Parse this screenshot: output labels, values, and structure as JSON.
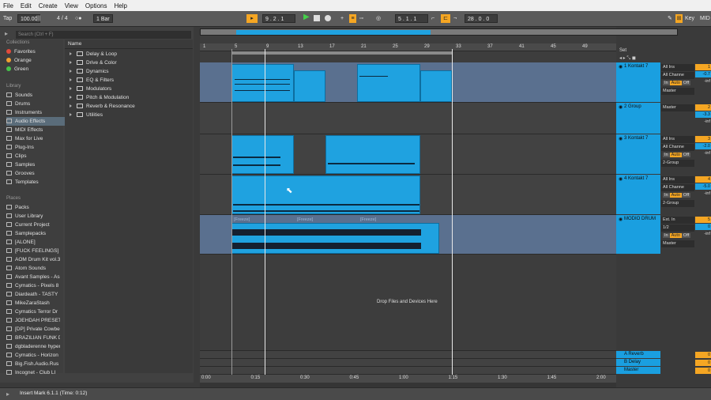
{
  "menu": [
    "File",
    "Edit",
    "Create",
    "View",
    "Options",
    "Help"
  ],
  "transport": {
    "tap": "Tap",
    "tempo": "100.00",
    "sig": "4 / 4",
    "quant": "1 Bar",
    "position": "9 . 2 . 1",
    "loop_start": "5 . 1 . 1",
    "loop_len": "28 . 0 . 0",
    "key": "Key",
    "midi": "MID"
  },
  "search_placeholder": "Search (Ctrl + F)",
  "collections": {
    "label": "Collections",
    "items": [
      {
        "name": "Favorites",
        "color": "#e24a3b"
      },
      {
        "name": "Orange",
        "color": "#f0a030"
      },
      {
        "name": "Green",
        "color": "#45c24a"
      }
    ]
  },
  "library": {
    "label": "Library",
    "items": [
      "Sounds",
      "Drums",
      "Instruments",
      "Audio Effects",
      "MIDI Effects",
      "Max for Live",
      "Plug-Ins",
      "Clips",
      "Samples",
      "Grooves",
      "Templates"
    ]
  },
  "places": {
    "label": "Places",
    "items": [
      "Packs",
      "User Library",
      "Current Project",
      "Samplepacks",
      "[ALONE]",
      "[FUCK FEELINGS] D",
      "AOM Drum Kit vol.3",
      "Atom Sounds",
      "Avant Samples - As",
      "Cymatics - Pixels 8",
      "Diardeath - TASTY",
      "MikeZaraStash",
      "Cymatics Terror Dr",
      "JOEHDAH PRESET S",
      "[DP] Private Cowbe",
      "BRAZILIAN FUNK D",
      "dgbladerenne hyper",
      "Cymatics - Horizon",
      "Big.Fish.Audio.Rus",
      "Incognet - Club LI"
    ]
  },
  "name_header": "Name",
  "folders": [
    "Delay & Loop",
    "Drive & Color",
    "Dynamics",
    "EQ & Filters",
    "Modulators",
    "Pitch & Modulation",
    "Reverb & Resonance",
    "Utilities"
  ],
  "ruler": [
    "1",
    "5",
    "9",
    "13",
    "17",
    "21",
    "25",
    "29",
    "33",
    "37",
    "41",
    "45",
    "49"
  ],
  "set_label": "Set",
  "tracks": [
    {
      "name": "1 Kontakt 7",
      "in": "All Ins",
      "ch": "All Channe",
      "out": "Master",
      "num": "1",
      "vol": "-0.7",
      "inf": "-inf"
    },
    {
      "name": "2 Group",
      "out": "Master",
      "num": "2",
      "vol": "-3.3",
      "inf": "-inf"
    },
    {
      "name": "3 Kontakt 7",
      "in": "All Ins",
      "ch": "All Channe",
      "out": "2-Group",
      "num": "3",
      "vol": "-2.0",
      "inf": "-inf"
    },
    {
      "name": "4 Kontakt 7",
      "in": "All Ins",
      "ch": "All Channe",
      "out": "2-Group",
      "num": "4",
      "vol": "-5.0",
      "inf": "-inf"
    },
    {
      "name": "MODIO DRUM",
      "in": "Ext. In",
      "ch": "1/2",
      "out": "Master",
      "num": "5",
      "vol": "0",
      "inf": "-inf"
    }
  ],
  "monitor": {
    "in": "In",
    "auto": "Auto",
    "off": "Off"
  },
  "freeze_label": "[Freeze]",
  "drop_text": "Drop Files and Devices Here",
  "returns": [
    {
      "name": "A Reverb",
      "num": "A",
      "vol": "0"
    },
    {
      "name": "B Delay",
      "num": "B",
      "vol": "0"
    },
    {
      "name": "Master",
      "num": "",
      "vol": "0",
      "out": "1/2"
    }
  ],
  "timeline": [
    "0:00",
    "0:15",
    "0:30",
    "0:45",
    "1:00",
    "1:15",
    "1:30",
    "1:45",
    "2:00"
  ],
  "status": "Insert Mark 6.1.1 (Time: 0:12)"
}
